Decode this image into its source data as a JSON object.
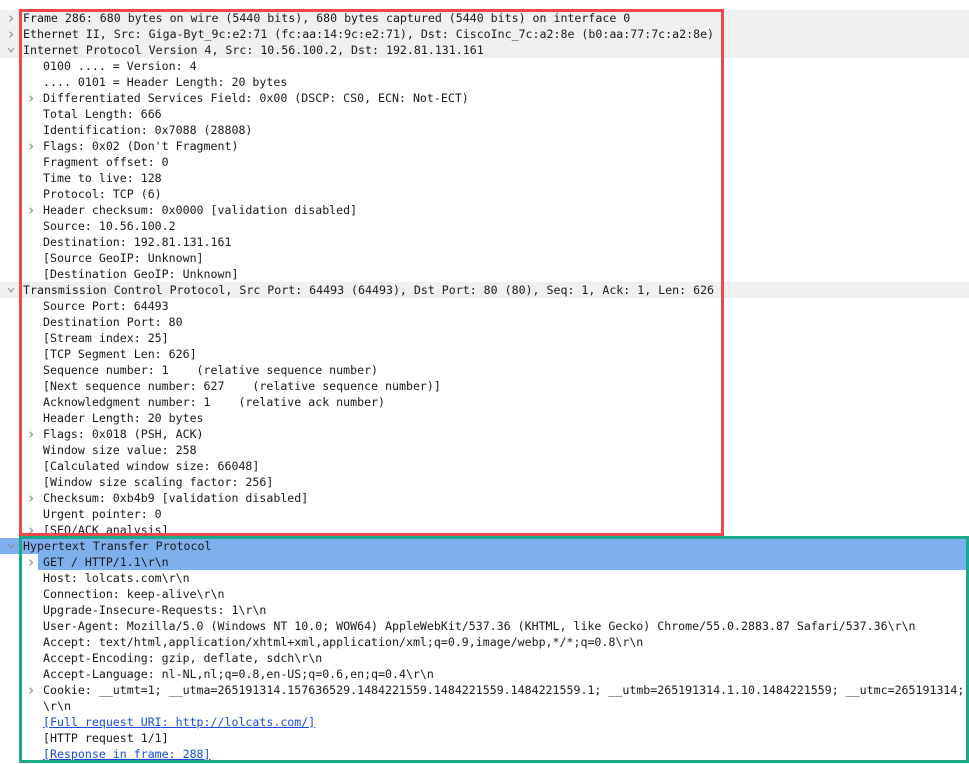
{
  "packet_details": [
    {
      "text": "Frame 286: 680 bytes on wire (5440 bits), 680 bytes captured (5440 bits) on interface 0",
      "level": 0,
      "expander": "collapsed"
    },
    {
      "text": "Ethernet II, Src: Giga-Byt_9c:e2:71 (fc:aa:14:9c:e2:71), Dst: CiscoInc_7c:a2:8e (b0:aa:77:7c:a2:8e)",
      "level": 0,
      "expander": "collapsed"
    },
    {
      "text": "Internet Protocol Version 4, Src: 10.56.100.2, Dst: 192.81.131.161",
      "level": 0,
      "expander": "expanded"
    },
    {
      "text": "0100 .... = Version: 4",
      "level": 1
    },
    {
      "text": ".... 0101 = Header Length: 20 bytes",
      "level": 1
    },
    {
      "text": "Differentiated Services Field: 0x00 (DSCP: CS0, ECN: Not-ECT)",
      "level": 1,
      "expander": "collapsed"
    },
    {
      "text": "Total Length: 666",
      "level": 1
    },
    {
      "text": "Identification: 0x7088 (28808)",
      "level": 1
    },
    {
      "text": "Flags: 0x02 (Don't Fragment)",
      "level": 1,
      "expander": "collapsed"
    },
    {
      "text": "Fragment offset: 0",
      "level": 1
    },
    {
      "text": "Time to live: 128",
      "level": 1
    },
    {
      "text": "Protocol: TCP (6)",
      "level": 1
    },
    {
      "text": "Header checksum: 0x0000 [validation disabled]",
      "level": 1,
      "expander": "collapsed"
    },
    {
      "text": "Source: 10.56.100.2",
      "level": 1
    },
    {
      "text": "Destination: 192.81.131.161",
      "level": 1
    },
    {
      "text": "[Source GeoIP: Unknown]",
      "level": 1
    },
    {
      "text": "[Destination GeoIP: Unknown]",
      "level": 1
    },
    {
      "text": "Transmission Control Protocol, Src Port: 64493 (64493), Dst Port: 80 (80), Seq: 1, Ack: 1, Len: 626",
      "level": 0,
      "expander": "expanded"
    },
    {
      "text": "Source Port: 64493",
      "level": 1
    },
    {
      "text": "Destination Port: 80",
      "level": 1
    },
    {
      "text": "[Stream index: 25]",
      "level": 1
    },
    {
      "text": "[TCP Segment Len: 626]",
      "level": 1
    },
    {
      "text": "Sequence number: 1    (relative sequence number)",
      "level": 1
    },
    {
      "text": "[Next sequence number: 627    (relative sequence number)]",
      "level": 1
    },
    {
      "text": "Acknowledgment number: 1    (relative ack number)",
      "level": 1
    },
    {
      "text": "Header Length: 20 bytes",
      "level": 1
    },
    {
      "text": "Flags: 0x018 (PSH, ACK)",
      "level": 1,
      "expander": "collapsed"
    },
    {
      "text": "Window size value: 258",
      "level": 1
    },
    {
      "text": "[Calculated window size: 66048]",
      "level": 1
    },
    {
      "text": "[Window size scaling factor: 256]",
      "level": 1
    },
    {
      "text": "Checksum: 0xb4b9 [validation disabled]",
      "level": 1,
      "expander": "collapsed"
    },
    {
      "text": "Urgent pointer: 0",
      "level": 1
    },
    {
      "text": "[SEQ/ACK analysis]",
      "level": 1,
      "expander": "collapsed"
    },
    {
      "text": "Hypertext Transfer Protocol",
      "level": 0,
      "expander": "expanded",
      "selected": "full"
    },
    {
      "text": "GET / HTTP/1.1\\r\\n",
      "level": 1,
      "expander": "collapsed",
      "selected": "partial"
    },
    {
      "text": "Host: lolcats.com\\r\\n",
      "level": 1
    },
    {
      "text": "Connection: keep-alive\\r\\n",
      "level": 1
    },
    {
      "text": "Upgrade-Insecure-Requests: 1\\r\\n",
      "level": 1
    },
    {
      "text": "User-Agent: Mozilla/5.0 (Windows NT 10.0; WOW64) AppleWebKit/537.36 (KHTML, like Gecko) Chrome/55.0.2883.87 Safari/537.36\\r\\n",
      "level": 1
    },
    {
      "text": "Accept: text/html,application/xhtml+xml,application/xml;q=0.9,image/webp,*/*;q=0.8\\r\\n",
      "level": 1
    },
    {
      "text": "Accept-Encoding: gzip, deflate, sdch\\r\\n",
      "level": 1
    },
    {
      "text": "Accept-Language: nl-NL,nl;q=0.8,en-US;q=0.6,en;q=0.4\\r\\n",
      "level": 1
    },
    {
      "text": "Cookie: __utmt=1; __utma=265191314.157636529.1484221559.1484221559.1484221559.1; __utmb=265191314.1.10.1484221559; __utmc=265191314;",
      "level": 1,
      "expander": "collapsed"
    },
    {
      "text": "\\r\\n",
      "level": 1
    },
    {
      "text": "[Full request URI: http://lolcats.com/]",
      "level": 1,
      "link": true
    },
    {
      "text": "[HTTP request 1/1]",
      "level": 1
    },
    {
      "text": "[Response in frame: 288]",
      "level": 1,
      "link": true
    }
  ],
  "colors": {
    "selection": "#7fb0ee",
    "ip_tcp_box": "#f04848",
    "http_box": "#1aaa8a",
    "link": "#1a4ed8"
  }
}
